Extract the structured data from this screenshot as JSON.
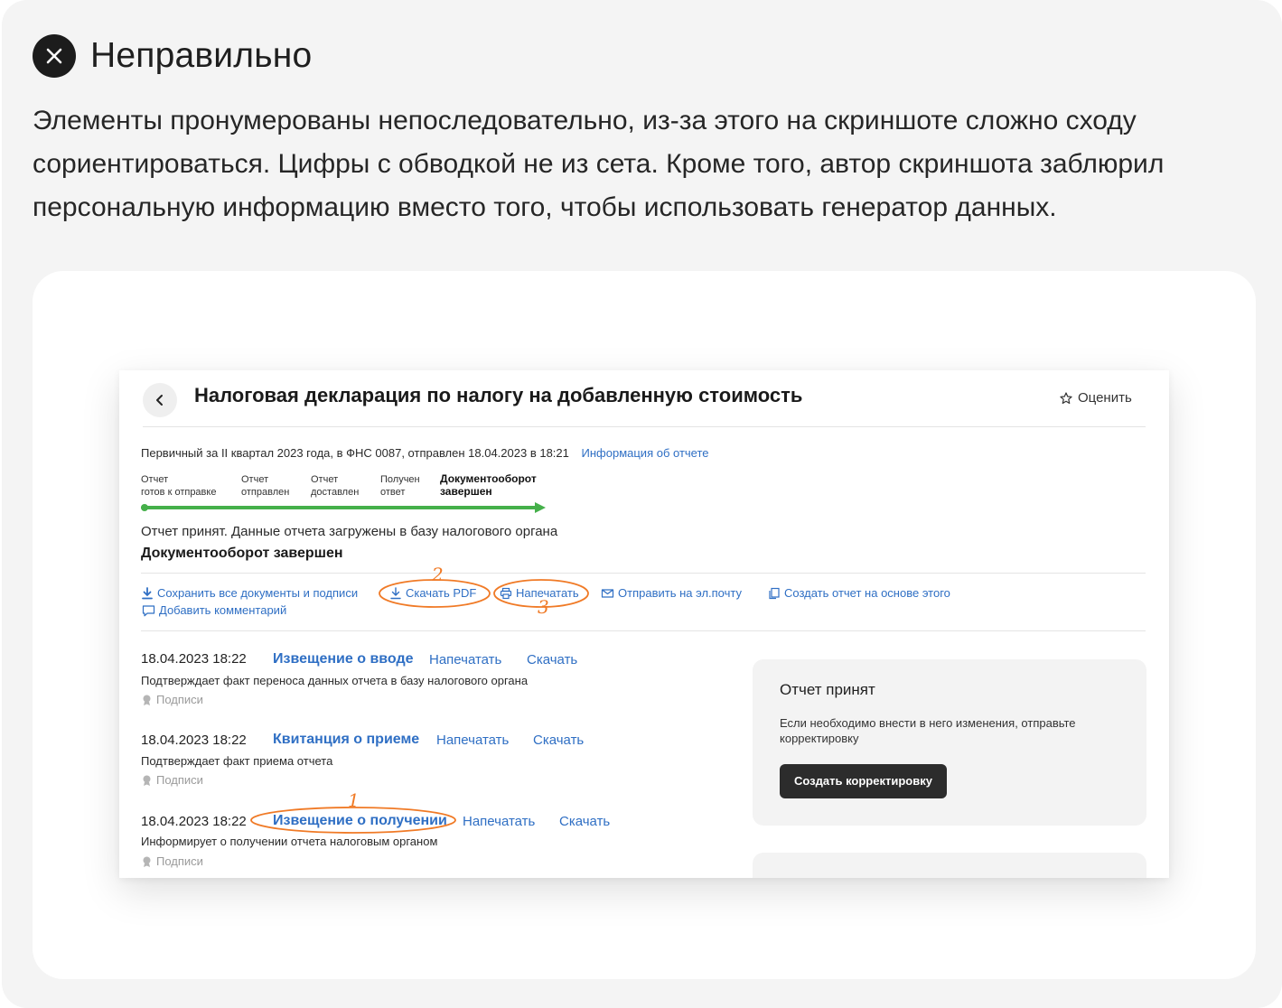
{
  "heading": {
    "icon": "close-icon",
    "title": "Неправильно"
  },
  "description": "Элементы пронумерованы непоследовательно, из-за этого на скриншоте сложно сходу сориентироваться. Цифры с обводкой не из сета. Кроме того, автор скриншота заблюрил персональную информацию вместо того, чтобы использовать генератор данных.",
  "colors": {
    "accent_link": "#2f6fc4",
    "annotation": "#f07a26",
    "progress": "#45b04a",
    "button_dark": "#2c2c2c"
  },
  "screenshot": {
    "title": "Налоговая декларация по налогу на добавленную стоимость",
    "rate_label": "Оценить",
    "meta_text": "Первичный за II квартал 2023 года, в ФНС 0087, отправлен 18.04.2023 в 18:21",
    "meta_link": "Информация об отчете",
    "steps": [
      {
        "line1": "Отчет",
        "line2": "готов к отправке"
      },
      {
        "line1": "Отчет",
        "line2": "отправлен"
      },
      {
        "line1": "Отчет",
        "line2": "доставлен"
      },
      {
        "line1": "Получен",
        "line2": "ответ"
      },
      {
        "line1": "Документооборот",
        "line2": "завершен"
      }
    ],
    "status_text": "Отчет принят. Данные отчета загружены в базу налогового органа",
    "status_bold": "Документооборот завершен",
    "actions": {
      "save_all": "Сохранить все документы и подписи",
      "download_pdf": "Скачать PDF",
      "print": "Напечатать",
      "email": "Отправить на эл.почту",
      "create_based": "Создать отчет на основе этого",
      "comment": "Добавить комментарий"
    },
    "documents": [
      {
        "date": "18.04.2023 18:22",
        "title": "Извещение о вводе",
        "print": "Напечатать",
        "download": "Скачать",
        "description": "Подтверждает факт переноса данных отчета в базу налогового органа",
        "signatures": "Подписи"
      },
      {
        "date": "18.04.2023 18:22",
        "title": "Квитанция о приеме",
        "print": "Напечатать",
        "download": "Скачать",
        "description": "Подтверждает факт приема отчета",
        "signatures": "Подписи"
      },
      {
        "date": "18.04.2023 18:22",
        "title": "Извещение о получении",
        "print": "Напечатать",
        "download": "Скачать",
        "description": "Информирует о получении отчета налоговым органом",
        "signatures": "Подписи"
      }
    ],
    "side_panel": {
      "title": "Отчет принят",
      "text": "Если необходимо внести в него изменения, отправьте корректировку",
      "button": "Создать корректировку"
    },
    "annotations": [
      "1",
      "2",
      "3"
    ]
  }
}
